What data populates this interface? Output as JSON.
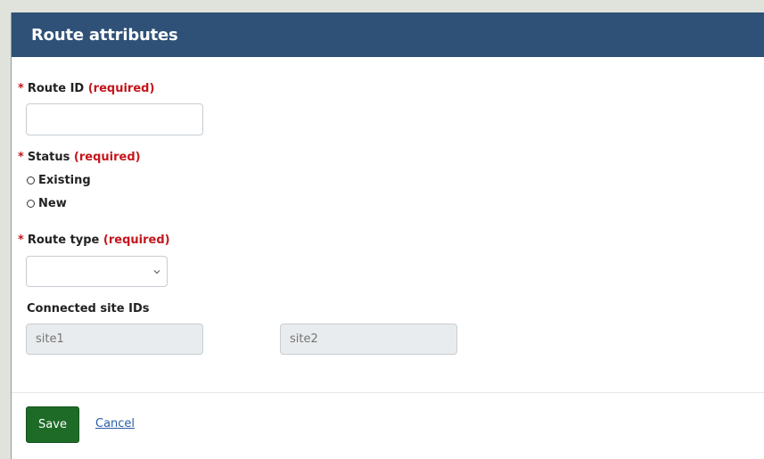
{
  "dialog": {
    "title": "Route attributes"
  },
  "fields": {
    "route_id": {
      "star": "*",
      "label": "Route ID",
      "required": "(required)",
      "value": ""
    },
    "status": {
      "star": "*",
      "label": "Status",
      "required": "(required)",
      "options": [
        "Existing",
        "New"
      ]
    },
    "route_type": {
      "star": "*",
      "label": "Route type",
      "required": "(required)",
      "selected": ""
    },
    "connected_sites": {
      "label": "Connected site IDs",
      "site1_placeholder": "site1",
      "site2_placeholder": "site2"
    }
  },
  "footer": {
    "save_label": "Save",
    "cancel_label": "Cancel"
  },
  "colors": {
    "header": "#2f5177",
    "required": "#c4161c",
    "save": "#1d6b27",
    "link": "#2a5ca8"
  },
  "icons": {
    "select": "chevron-down-icon",
    "radio": "radio-unchecked-icon"
  }
}
